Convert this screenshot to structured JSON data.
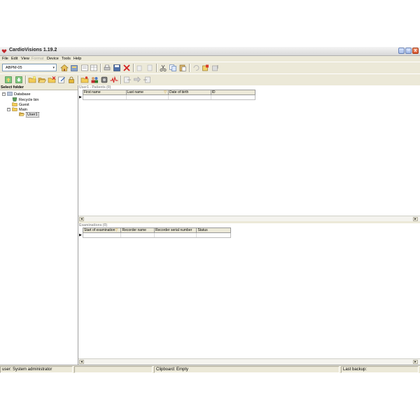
{
  "window": {
    "title": "CardioVisions 1.19.2",
    "controls": {
      "minimize": "_",
      "restore": "▫",
      "close": "x"
    }
  },
  "menu": {
    "items": [
      {
        "label": "File",
        "enabled": true
      },
      {
        "label": "Edit",
        "enabled": true
      },
      {
        "label": "View",
        "enabled": true
      },
      {
        "label": "Format",
        "enabled": false
      },
      {
        "label": "Device",
        "enabled": true
      },
      {
        "label": "Tools",
        "enabled": true
      },
      {
        "label": "Help",
        "enabled": true
      }
    ]
  },
  "toolbar": {
    "device_select": "ABPM-05",
    "device_arrow": "▾",
    "row1_icons": [
      "home-icon",
      "database-icon",
      "report-icon",
      "table-icon",
      "print-icon",
      "save-icon",
      "delete-icon",
      "copy-disabled-icon",
      "paste-disabled-icon",
      "cut-icon",
      "copy-icon",
      "paste-icon",
      "undo-icon",
      "export-icon",
      "import-icon"
    ],
    "row2_icons": [
      "upload-icon",
      "download-icon",
      "new-folder-icon",
      "open-folder-icon",
      "delete-folder-icon",
      "edit-icon",
      "lock-icon",
      "new-patient-icon",
      "patients-icon",
      "recorder-icon",
      "ecg-icon",
      "send-icon",
      "forward-icon",
      "receive-icon"
    ]
  },
  "tree": {
    "header": "Select folder",
    "nodes": [
      {
        "label": "Database",
        "level": 0,
        "expander": "−",
        "icon": "database-icon"
      },
      {
        "label": "Recycle bin",
        "level": 1,
        "expander": "",
        "icon": "recycle-bin-icon"
      },
      {
        "label": "Guest",
        "level": 1,
        "expander": "",
        "icon": "folder-icon"
      },
      {
        "label": "Main",
        "level": 1,
        "expander": "−",
        "icon": "folder-icon"
      },
      {
        "label": "User1",
        "level": 2,
        "expander": "",
        "icon": "folder-open-icon",
        "selected": true
      }
    ]
  },
  "patients": {
    "title": "User1 - Patients (0)",
    "columns": [
      {
        "label": "First name"
      },
      {
        "label": "Last name",
        "sort": "▽"
      },
      {
        "label": "Date of birth"
      },
      {
        "label": "ID"
      }
    ],
    "row_indicator": "▶"
  },
  "examinations": {
    "title": "Examinations (0)",
    "columns": [
      {
        "label": "Start of examination",
        "sort": "▽"
      },
      {
        "label": "Recorder name"
      },
      {
        "label": "Recorder serial number"
      },
      {
        "label": "Status"
      }
    ],
    "row_indicator": "▶"
  },
  "scroll": {
    "left": "◂",
    "right": "▸"
  },
  "status": {
    "user": "user: System administrator",
    "clipboard": "Clipboard: Empty",
    "last_backup": "Last backup:"
  }
}
